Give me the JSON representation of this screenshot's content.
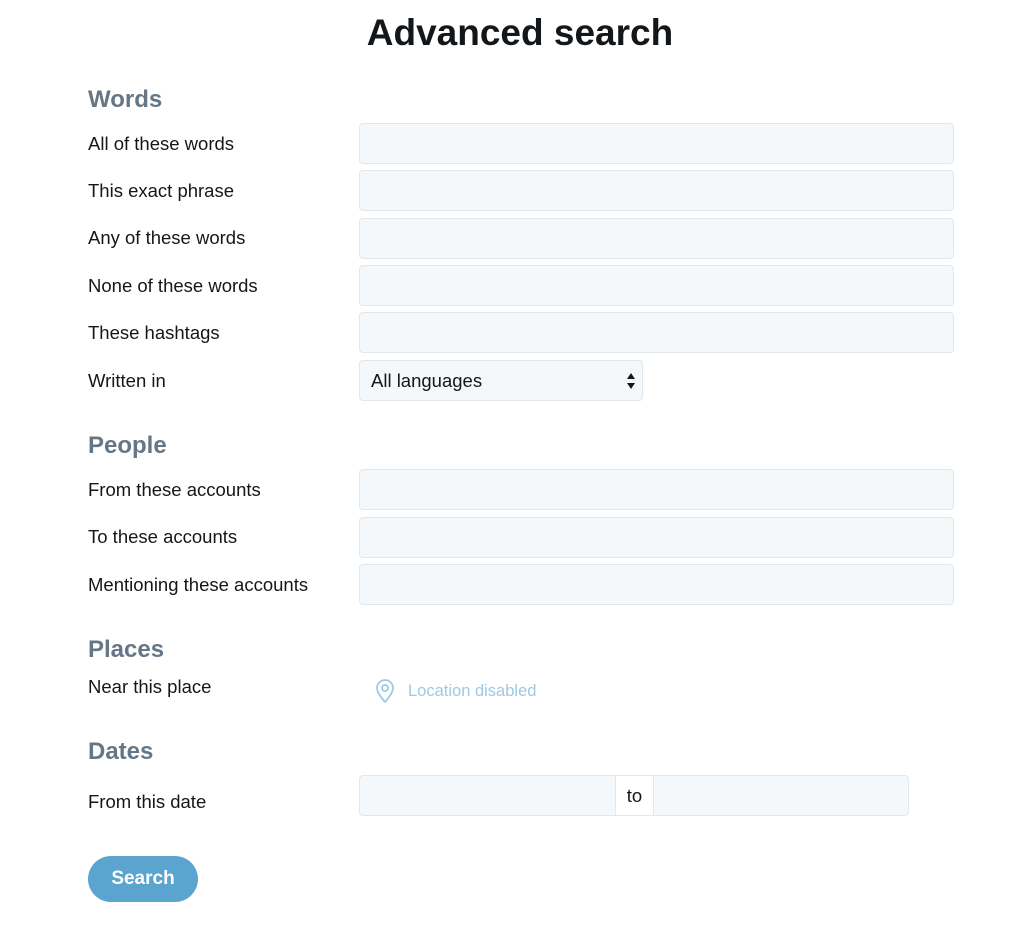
{
  "title": "Advanced search",
  "sections": {
    "words": {
      "heading": "Words",
      "all_words_label": "All of these words",
      "exact_phrase_label": "This exact phrase",
      "any_words_label": "Any of these words",
      "none_words_label": "None of these words",
      "hashtags_label": "These hashtags",
      "language_label": "Written in",
      "language_selected": "All languages"
    },
    "people": {
      "heading": "People",
      "from_label": "From these accounts",
      "to_label": "To these accounts",
      "mentioning_label": "Mentioning these accounts"
    },
    "places": {
      "heading": "Places",
      "near_label": "Near this place",
      "location_status": "Location disabled",
      "location_icon": "map-pin-icon"
    },
    "dates": {
      "heading": "Dates",
      "from_label": "From this date",
      "separator": "to"
    }
  },
  "search_button": "Search",
  "colors": {
    "heading": "#657786",
    "input_bg": "#f5f8fa",
    "input_border": "#e1e8ed",
    "accent": "#5ba4d0",
    "disabled_text": "#9fc9e2"
  }
}
